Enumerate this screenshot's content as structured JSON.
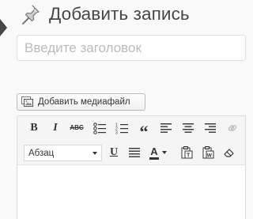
{
  "header": {
    "title": "Добавить запись",
    "icon": "pushpin-icon"
  },
  "title_field": {
    "placeholder": "Введите заголовок",
    "value": ""
  },
  "media": {
    "button_label": "Добавить медиафайл",
    "icon": "media-library-icon"
  },
  "editor": {
    "toolbar_row1": [
      {
        "name": "bold-button",
        "glyph": "B"
      },
      {
        "name": "italic-button",
        "glyph": "I"
      },
      {
        "name": "strikethrough-button",
        "glyph": "ABC"
      },
      {
        "name": "bulleted-list-button",
        "icon": "bullet-list-icon"
      },
      {
        "name": "numbered-list-button",
        "icon": "numbered-list-icon"
      },
      {
        "name": "blockquote-button",
        "glyph": "“"
      },
      {
        "name": "align-left-button",
        "icon": "align-left-icon"
      },
      {
        "name": "align-center-button",
        "icon": "align-center-icon"
      },
      {
        "name": "align-right-button",
        "icon": "align-right-icon"
      },
      {
        "name": "insert-link-button",
        "icon": "link-icon"
      }
    ],
    "format_select": {
      "selected": "Абзац"
    },
    "toolbar_row2": [
      {
        "name": "underline-button",
        "glyph": "U"
      },
      {
        "name": "justify-button",
        "icon": "align-justify-icon"
      },
      {
        "name": "text-color-button",
        "glyph": "A"
      },
      {
        "name": "paste-as-text-button",
        "icon": "paste-text-icon"
      },
      {
        "name": "paste-from-word-button",
        "icon": "paste-word-icon"
      },
      {
        "name": "clear-formatting-button",
        "icon": "eraser-icon"
      }
    ],
    "content": ""
  },
  "colors": {
    "text": "#464646",
    "accent_text_color": "#333333",
    "background": "#f9f9f9"
  }
}
